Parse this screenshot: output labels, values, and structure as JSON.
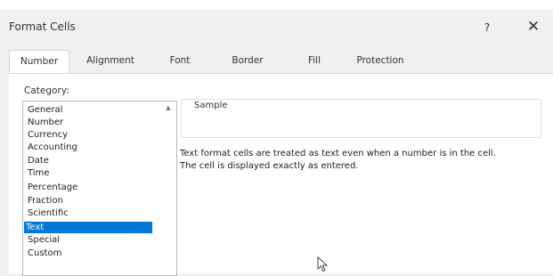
{
  "dialog": {
    "title": "Format Cells",
    "help_label": "?",
    "close_label": "✕"
  },
  "tabs": [
    {
      "label": "Number",
      "active": true
    },
    {
      "label": "Alignment",
      "active": false
    },
    {
      "label": "Font",
      "active": false
    },
    {
      "label": "Border",
      "active": false
    },
    {
      "label": "Fill",
      "active": false
    },
    {
      "label": "Protection",
      "active": false
    }
  ],
  "category": {
    "label": "Category:",
    "items": [
      "General",
      "Number",
      "Currency",
      "Accounting",
      "Date",
      "Time",
      "Percentage",
      "Fraction",
      "Scientific",
      "Text",
      "Special",
      "Custom"
    ],
    "selected": "Text"
  },
  "sample": {
    "label": "Sample",
    "value": ""
  },
  "description": {
    "line1": "Text format cells are treated as text even when a number is in the cell.",
    "line2": "The cell is displayed exactly as entered."
  },
  "colors": {
    "selection": "#0078d7",
    "panel_background": "#ffffff",
    "dialog_background": "#f0f0f0"
  },
  "icons": {
    "close": "close-icon",
    "help": "help-icon",
    "cursor": "mouse-pointer-icon",
    "scroll_up": "chevron-up-icon"
  }
}
